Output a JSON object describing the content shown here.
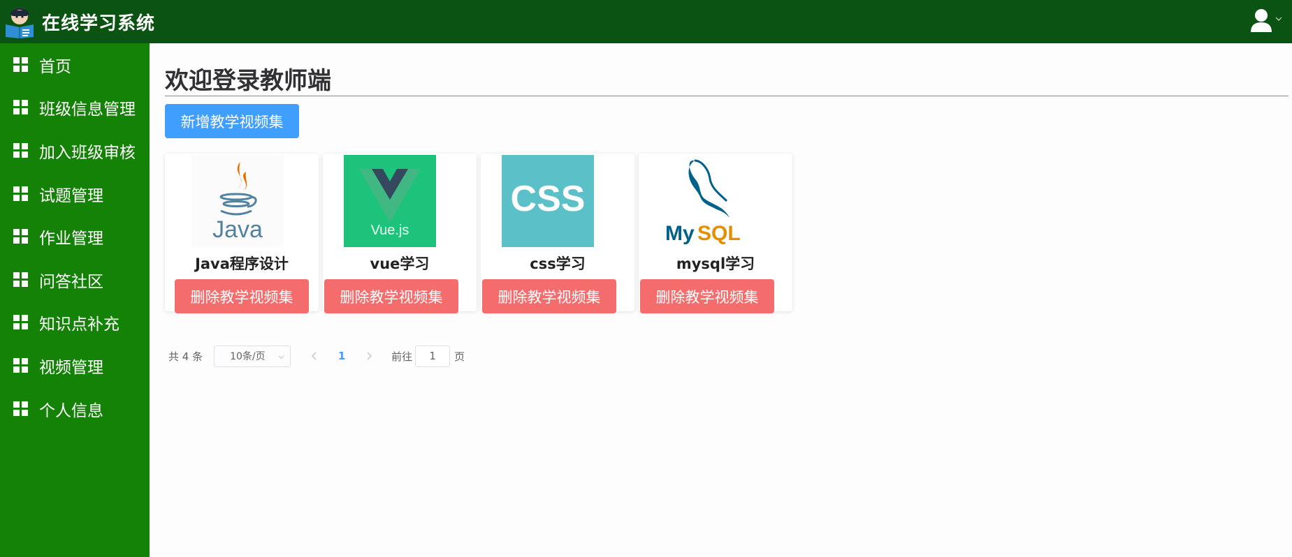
{
  "header": {
    "app_title": "在线学习系统",
    "logo_icon": "student-reading-icon",
    "user_icon": "user-avatar-icon",
    "colors": {
      "header_bg": "#0a5312"
    }
  },
  "sidebar": {
    "bg_color": "#148207",
    "items": [
      {
        "label": "首页",
        "icon": "grid-icon"
      },
      {
        "label": "班级信息管理",
        "icon": "grid-icon"
      },
      {
        "label": "加入班级审核",
        "icon": "grid-icon"
      },
      {
        "label": "试题管理",
        "icon": "grid-icon"
      },
      {
        "label": "作业管理",
        "icon": "grid-icon"
      },
      {
        "label": "问答社区",
        "icon": "grid-icon"
      },
      {
        "label": "知识点补充",
        "icon": "grid-icon"
      },
      {
        "label": "视频管理",
        "icon": "grid-icon"
      },
      {
        "label": "个人信息",
        "icon": "grid-icon"
      }
    ]
  },
  "main": {
    "title": "欢迎登录教师端",
    "add_button_label": "新增教学视频集",
    "cards": [
      {
        "name": "Java程序设计",
        "thumb": "java-logo",
        "delete_label": "删除教学视频集"
      },
      {
        "name": "vue学习",
        "thumb": "vuejs-logo",
        "delete_label": "删除教学视频集"
      },
      {
        "name": "css学习",
        "thumb": "css-logo",
        "delete_label": "删除教学视频集"
      },
      {
        "name": "mysql学习",
        "thumb": "mysql-logo",
        "delete_label": "删除教学视频集"
      }
    ],
    "colors": {
      "primary": "#409eff",
      "danger": "#f56c6c"
    }
  },
  "pagination": {
    "total_text": "共 4 条",
    "page_size": "10条/页",
    "current_page": "1",
    "jump_label": "前往",
    "jump_value": "1",
    "jump_suffix": "页"
  }
}
